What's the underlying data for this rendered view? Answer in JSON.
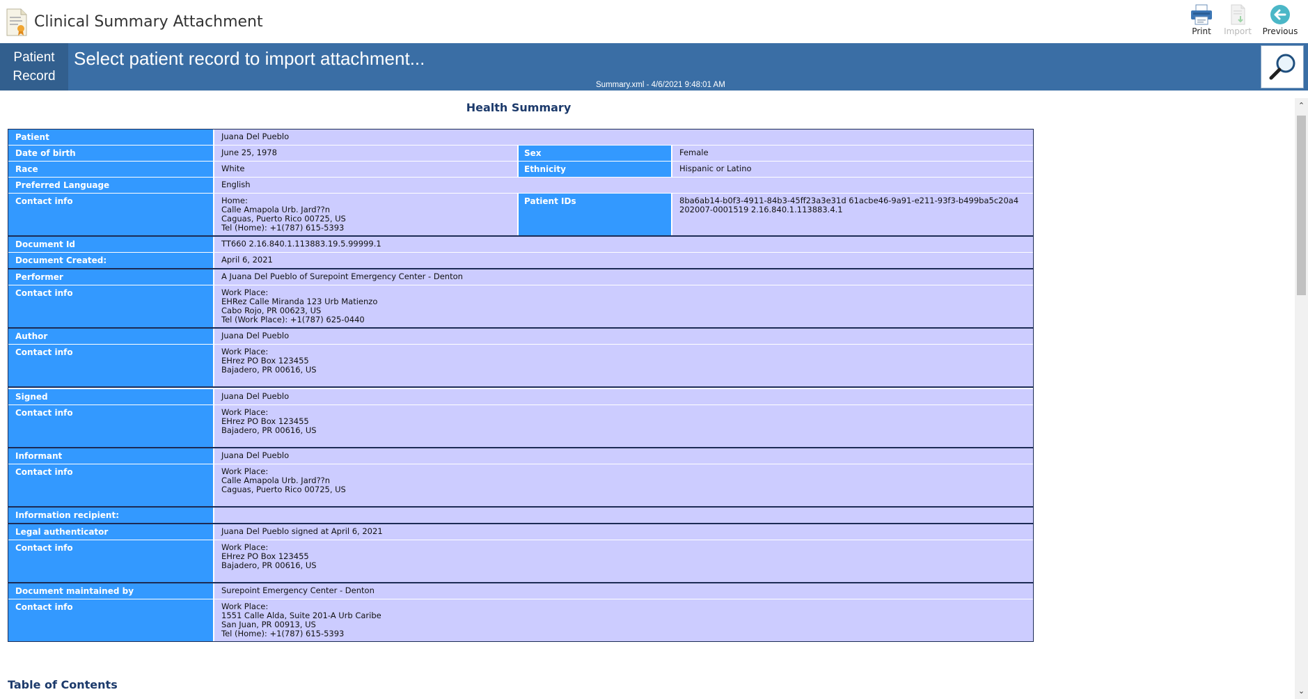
{
  "window": {
    "title": "Clinical Summary Attachment",
    "toolbar": {
      "print_label": "Print",
      "import_label": "Import",
      "previous_label": "Previous"
    }
  },
  "banner": {
    "patient_record_line1": "Patient",
    "patient_record_line2": "Record",
    "message": "Select patient record to import attachment...",
    "file_info": "Summary.xml - 4/6/2021 9:48:01 AM"
  },
  "document": {
    "title": "Health Summary",
    "patient": {
      "patient_label": "Patient",
      "patient_value": "Juana Del Pueblo",
      "dob_label": "Date of birth",
      "dob_value": "June 25, 1978",
      "sex_label": "Sex",
      "sex_value": "Female",
      "race_label": "Race",
      "race_value": "White",
      "ethnicity_label": "Ethnicity",
      "ethnicity_value": "Hispanic or Latino",
      "language_label": "Preferred Language",
      "language_value": "English",
      "contact_label": "Contact info",
      "contact_value": "Home:\nCalle Amapola Urb. Jard??n\nCaguas, Puerto Rico 00725, US\nTel (Home): +1(787) 615-5393",
      "ids_label": "Patient IDs",
      "ids_value": "8ba6ab14-b0f3-4911-84b3-45ff23a3e31d 61acbe46-9a91-e211-93f3-b499ba5c20a4\n202007-0001519 2.16.840.1.113883.4.1"
    },
    "doc_info": {
      "id_label": "Document Id",
      "id_value": "TT660 2.16.840.1.113883.19.5.99999.1",
      "created_label": "Document Created:",
      "created_value": "April 6, 2021"
    },
    "performer": {
      "label": "Performer",
      "value": "A Juana Del Pueblo of Surepoint Emergency Center - Denton",
      "contact_label": "Contact info",
      "contact_value": "Work Place:\nEHRez Calle Miranda 123 Urb Matienzo\nCabo Rojo, PR 00623, US\nTel (Work Place): +1(787) 625-0440"
    },
    "author": {
      "label": "Author",
      "value": "Juana Del Pueblo",
      "contact_label": "Contact info",
      "contact_value": "Work Place:\nEHrez PO Box 123455\nBajadero, PR 00616, US"
    },
    "signed": {
      "label": "Signed",
      "value": "Juana Del Pueblo",
      "contact_label": "Contact info",
      "contact_value": "Work Place:\nEHrez PO Box 123455\nBajadero, PR 00616, US"
    },
    "informant": {
      "label": "Informant",
      "value": "Juana Del Pueblo",
      "contact_label": "Contact info",
      "contact_value": "Work Place:\nCalle Amapola Urb. Jard??n\nCaguas, Puerto Rico 00725, US"
    },
    "recipient": {
      "label": "Information recipient:",
      "value": ""
    },
    "legal": {
      "label": "Legal authenticator",
      "value": "Juana Del Pueblo signed at April 6, 2021",
      "contact_label": "Contact info",
      "contact_value": "Work Place:\nEHrez PO Box 123455\nBajadero, PR 00616, US"
    },
    "maintained": {
      "label": "Document maintained by",
      "value": "Surepoint Emergency Center - Denton",
      "contact_label": "Contact info",
      "contact_value": "Work Place:\n1551 Calle Alda, Suite 201-A Urb Caribe\nSan Juan, PR 00913, US\nTel (Home): +1(787) 615-5393"
    },
    "toc_heading": "Table of Contents"
  },
  "icons": {
    "app": "certificate-document-icon",
    "print": "printer-icon",
    "import": "import-document-icon",
    "previous": "back-arrow-icon",
    "search": "magnifier-icon"
  },
  "colors": {
    "banner": "#3a6ea5",
    "label_cell": "#3399ff",
    "value_cell": "#ccccff",
    "heading": "#1c3a6b"
  }
}
